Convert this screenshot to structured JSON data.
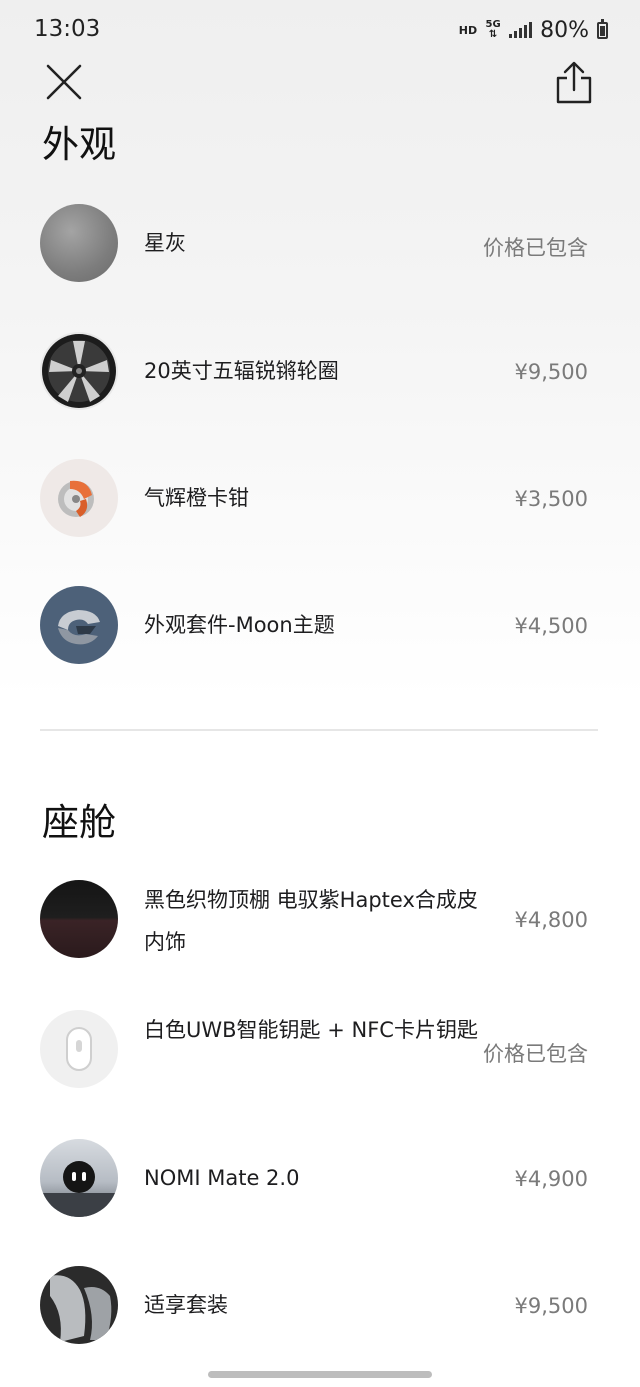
{
  "status_bar": {
    "time": "13:03",
    "hd": "HD",
    "network": "5G",
    "battery": "80%"
  },
  "toolbar": {
    "close_icon": "close-icon",
    "share_icon": "share-icon"
  },
  "sections": [
    {
      "title": "外观",
      "items": [
        {
          "name": "星灰",
          "price": "价格已包含",
          "thumb": "gray-paint-swatch"
        },
        {
          "name": "20英寸五辐锐锵轮圈",
          "price": "¥9,500",
          "thumb": "wheel-rim"
        },
        {
          "name": "气辉橙卡钳",
          "price": "¥3,500",
          "thumb": "orange-brake-caliper"
        },
        {
          "name": "外观套件-Moon主题",
          "price": "¥4,500",
          "thumb": "moon-theme-kit"
        }
      ]
    },
    {
      "title": "座舱",
      "items": [
        {
          "name": "黑色织物顶棚 电驭紫Haptex合成皮内饰",
          "price": "¥4,800",
          "thumb": "interior-swatch"
        },
        {
          "name": "白色UWB智能钥匙 + NFC卡片钥匙",
          "price": "价格已包含",
          "thumb": "smart-key"
        },
        {
          "name": "NOMI Mate 2.0",
          "price": "¥4,900",
          "thumb": "nomi-mate"
        },
        {
          "name": "适享套装",
          "price": "¥9,500",
          "thumb": "comfort-seat"
        }
      ]
    }
  ]
}
